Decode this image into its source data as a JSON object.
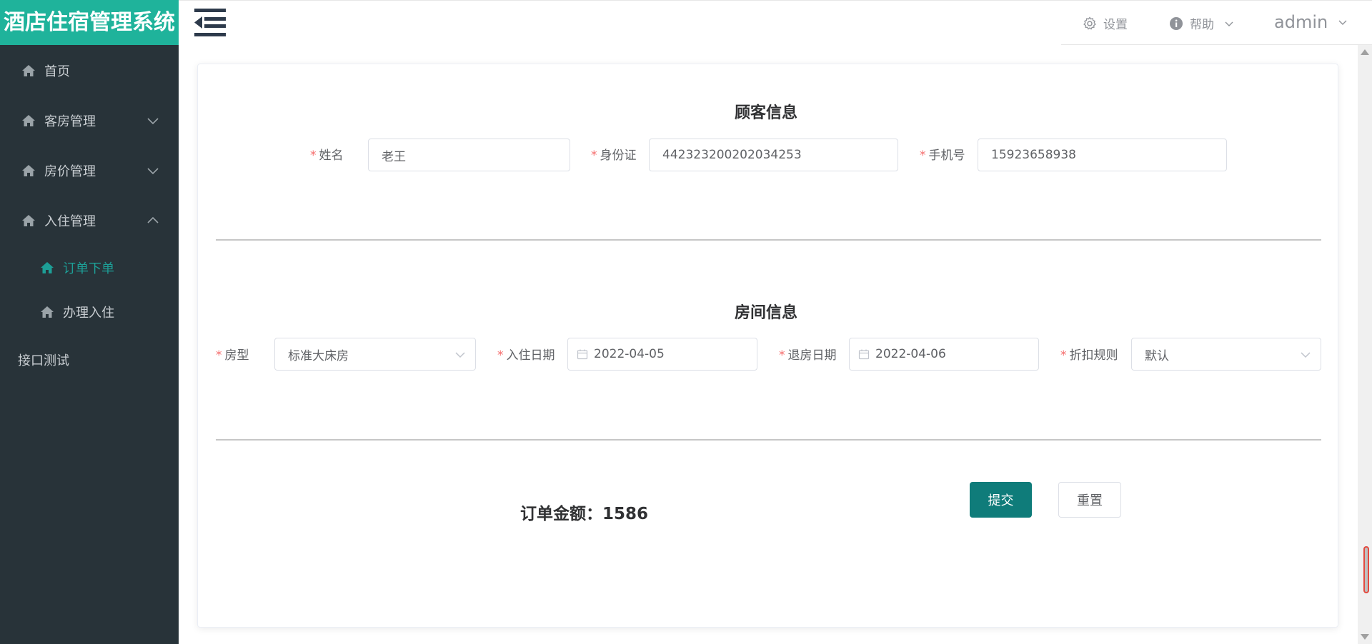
{
  "app": {
    "title": "酒店住宿管理系统"
  },
  "sidebar": {
    "items": [
      {
        "label": "首页"
      },
      {
        "label": "客房管理"
      },
      {
        "label": "房价管理"
      },
      {
        "label": "入住管理"
      },
      {
        "label": "订单下单"
      },
      {
        "label": "办理入住"
      },
      {
        "label": "接口测试"
      }
    ]
  },
  "header": {
    "settings_label": "设置",
    "help_label": "帮助",
    "user_name": "admin"
  },
  "customer": {
    "title": "顾客信息",
    "name_label": "姓名",
    "name_value": "老王",
    "id_label": "身份证",
    "id_value": "442323200202034253",
    "phone_label": "手机号",
    "phone_value": "15923658938"
  },
  "room": {
    "title": "房间信息",
    "type_label": "房型",
    "type_value": "标准大床房",
    "checkin_label": "入住日期",
    "checkin_value": "2022-04-05",
    "checkout_label": "退房日期",
    "checkout_value": "2022-04-06",
    "discount_label": "折扣规则",
    "discount_value": "默认"
  },
  "order": {
    "total_label": "订单金额：",
    "total_value": "1586",
    "submit_label": "提交",
    "reset_label": "重置"
  },
  "colors": {
    "logo_bg": "#1fb39b",
    "sidebar_bg": "#283339",
    "active_menu": "#1d9f97",
    "primary_button": "#0f7c7a",
    "required_star": "#f56c6c"
  }
}
